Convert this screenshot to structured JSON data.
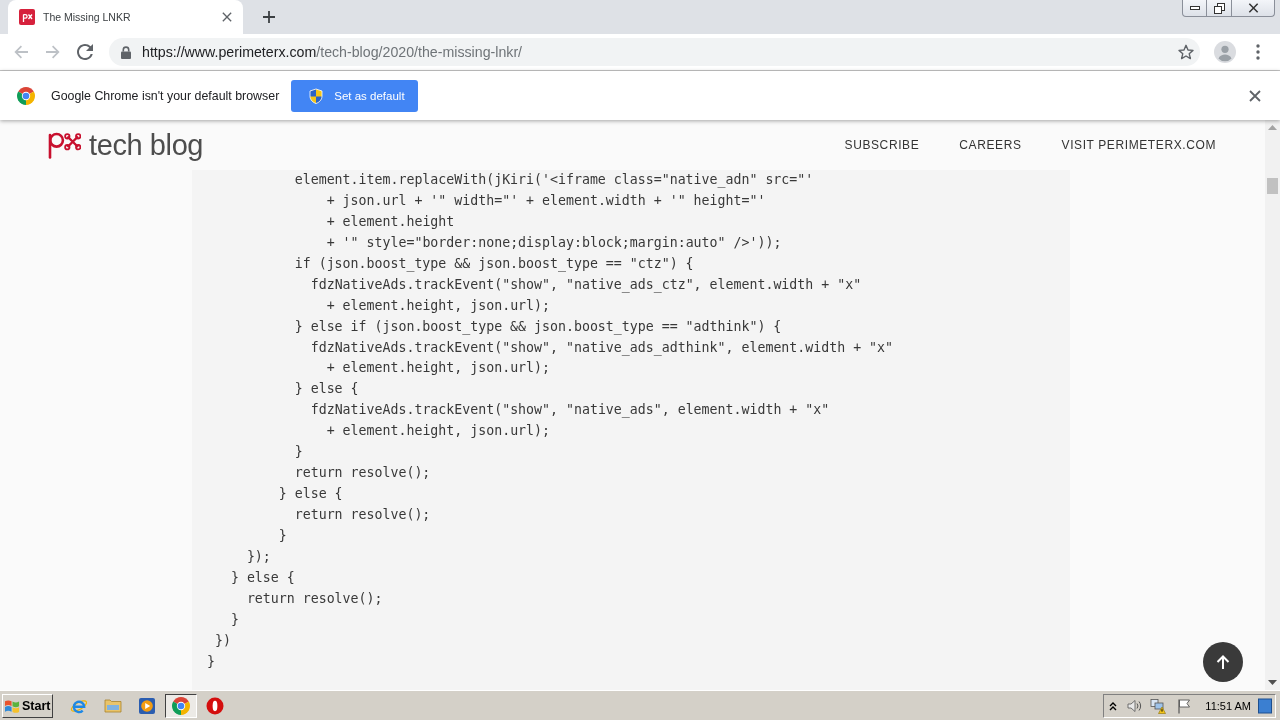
{
  "browser": {
    "tabs": [
      {
        "title": "The Missing LNKR",
        "selected": true
      }
    ],
    "nav_buttons": [
      {
        "kind": "back",
        "disabled": true
      },
      {
        "kind": "forward",
        "disabled": true
      },
      {
        "kind": "reload",
        "disabled": false
      }
    ],
    "address": {
      "host": "https://www.perimeterx.com",
      "path": "/tech-blog/2020/the-missing-lnkr/"
    }
  },
  "infobar": {
    "message": "Google Chrome isn't your default browser",
    "button": "Set as default"
  },
  "page": {
    "header": {
      "logo_text": "tech blog",
      "nav": [
        "SUBSCRIBE",
        "CAREERS",
        "VISIT PERIMETERX.COM"
      ]
    },
    "code_lines": [
      "           element.item.replaceWith(jKiri('<iframe class=\"native_adn\" src=\"'",
      "               + json.url + '\" width=\"' + element.width + '\" height=\"'",
      "               + element.height",
      "               + '\" style=\"border:none;display:block;margin:auto\" />'));",
      "           if (json.boost_type && json.boost_type == \"ctz\") {",
      "             fdzNativeAds.trackEvent(\"show\", \"native_ads_ctz\", element.width + \"x\"",
      "               + element.height, json.url);",
      "           } else if (json.boost_type && json.boost_type == \"adthink\") {",
      "             fdzNativeAds.trackEvent(\"show\", \"native_ads_adthink\", element.width + \"x\"",
      "               + element.height, json.url);",
      "           } else {",
      "             fdzNativeAds.trackEvent(\"show\", \"native_ads\", element.width + \"x\"",
      "               + element.height, json.url);",
      "           }",
      "           return resolve();",
      "         } else {",
      "           return resolve();",
      "         }",
      "     });",
      "   } else {",
      "     return resolve();",
      "   }",
      " })",
      "}"
    ]
  },
  "taskbar": {
    "start": "Start",
    "apps": [
      {
        "kind": "ie",
        "selected": false
      },
      {
        "kind": "folder",
        "selected": false
      },
      {
        "kind": "media",
        "selected": false
      },
      {
        "kind": "chrome",
        "selected": true
      },
      {
        "kind": "ring",
        "selected": false
      }
    ],
    "clock": "11:51 AM"
  }
}
